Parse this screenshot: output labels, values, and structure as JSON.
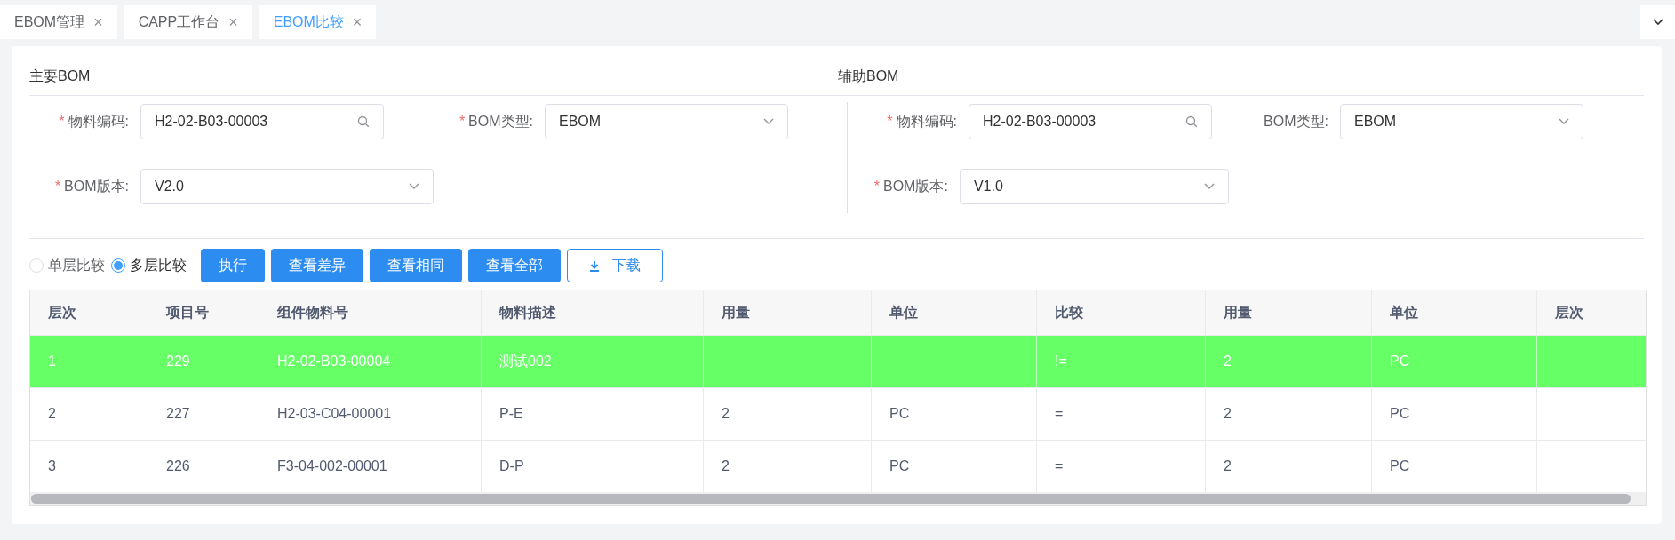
{
  "tabs": [
    {
      "label": "EBOM管理",
      "selected": false,
      "close": "×"
    },
    {
      "label": "CAPP工作台",
      "selected": false,
      "close": "×"
    },
    {
      "label": "EBOM比较",
      "selected": true,
      "close": "×"
    }
  ],
  "sections": [
    {
      "title": "主要BOM",
      "rows": [
        [
          {
            "label": "物料编码:",
            "required": true,
            "kind": "search",
            "value": "H2-02-B03-00003"
          },
          {
            "label": "BOM类型:",
            "required": true,
            "kind": "select",
            "value": "EBOM"
          }
        ],
        [
          {
            "label": "BOM版本:",
            "required": true,
            "kind": "select",
            "value": "V2.0",
            "wide": true
          }
        ]
      ]
    },
    {
      "title": "辅助BOM",
      "rows": [
        [
          {
            "label": "物料编码:",
            "required": true,
            "kind": "search",
            "value": "H2-02-B03-00003"
          },
          {
            "label": "BOM类型:",
            "required": false,
            "kind": "select",
            "value": "EBOM"
          }
        ],
        [
          {
            "label": "BOM版本:",
            "required": true,
            "kind": "select",
            "value": "V1.0",
            "wide": true
          }
        ]
      ]
    }
  ],
  "required_mark": "*",
  "compare_modes": [
    {
      "label": "单层比较",
      "selected": false
    },
    {
      "label": "多层比较",
      "selected": true
    }
  ],
  "buttons": [
    {
      "label": "执行",
      "kind": "primary"
    },
    {
      "label": "查看差异",
      "kind": "primary"
    },
    {
      "label": "查看相同",
      "kind": "primary"
    },
    {
      "label": "查看全部",
      "kind": "primary"
    },
    {
      "label": "下载",
      "kind": "download"
    }
  ],
  "table": {
    "columns": [
      "层次",
      "项目号",
      "组件物料号",
      "物料描述",
      "用量",
      "单位",
      "比较",
      "用量",
      "单位",
      "层次"
    ],
    "rows": [
      {
        "highlighted": true,
        "cells": [
          "1",
          "229",
          "H2-02-B03-00004",
          "测试002",
          null,
          null,
          "!=",
          "2",
          "PC",
          null
        ]
      },
      {
        "highlighted": false,
        "cells": [
          "2",
          "227",
          "H2-03-C04-00001",
          "P-E",
          "2",
          "PC",
          "=",
          "2",
          "PC",
          null
        ]
      },
      {
        "highlighted": false,
        "cells": [
          "3",
          "226",
          "F3-04-002-00001",
          "D-P",
          "2",
          "PC",
          "=",
          "2",
          "PC",
          null
        ]
      }
    ]
  }
}
